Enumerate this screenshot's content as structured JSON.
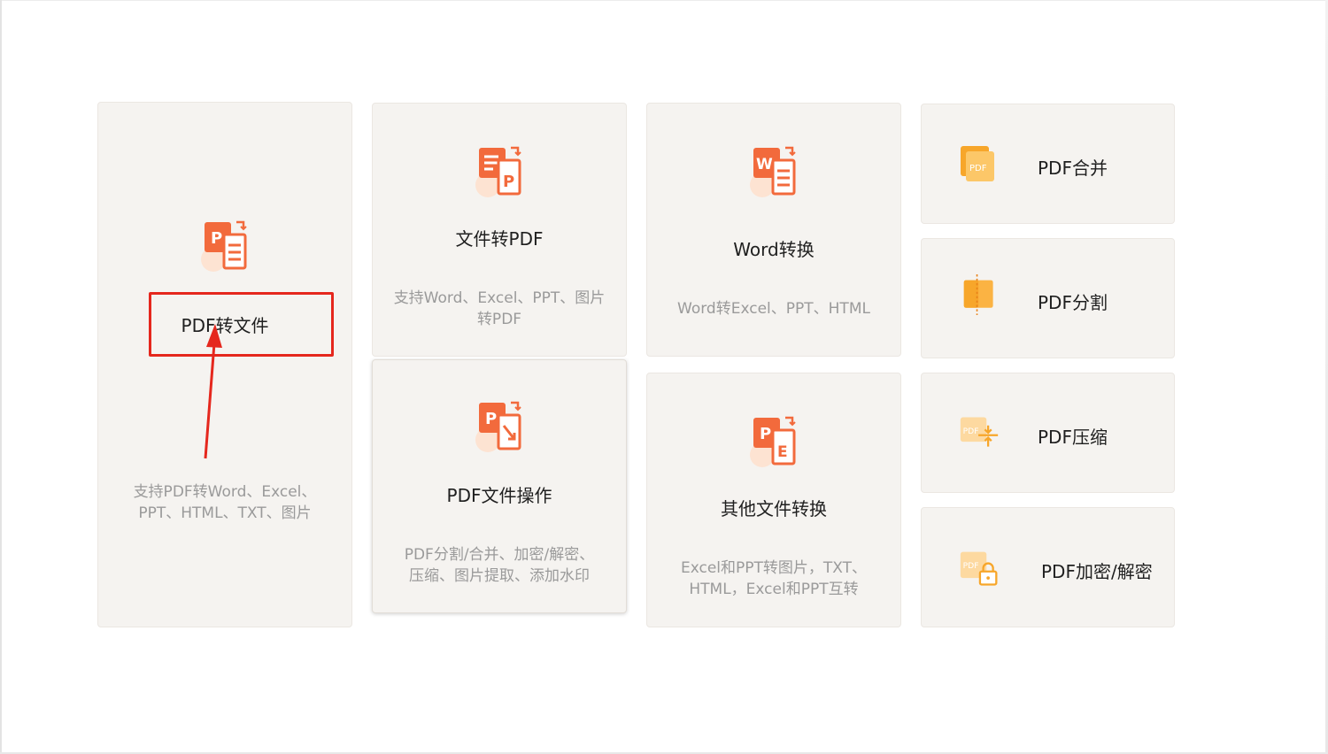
{
  "cards": {
    "pdf_to_file": {
      "title": "PDF转文件",
      "desc_lines": [
        "支持PDF转Word、Excel、",
        "PPT、HTML、TXT、图片"
      ]
    },
    "file_to_pdf": {
      "title": "文件转PDF",
      "desc_lines": [
        "支持Word、Excel、PPT、图片",
        "转PDF"
      ]
    },
    "word_convert": {
      "title": "Word转换",
      "desc_lines": [
        "Word转Excel、PPT、HTML"
      ]
    },
    "pdf_file_ops": {
      "title": "PDF文件操作",
      "desc_lines": [
        "PDF分割/合并、加密/解密、",
        "压缩、图片提取、添加水印"
      ]
    },
    "other_convert": {
      "title": "其他文件转换",
      "desc_lines": [
        "Excel和PPT转图片，TXT、",
        "HTML，Excel和PPT互转"
      ]
    }
  },
  "tools": {
    "merge": {
      "label": "PDF合并"
    },
    "split": {
      "label": "PDF分割"
    },
    "compress": {
      "label": "PDF压缩"
    },
    "encrypt": {
      "label": "PDF加密/解密"
    }
  },
  "icons": {
    "pdf_to_file": "pdf-to-file-icon",
    "file_to_pdf": "file-to-pdf-icon",
    "word_convert": "word-convert-icon",
    "pdf_file_ops": "pdf-ops-icon",
    "other_convert": "other-convert-icon",
    "merge": "pdf-merge-icon",
    "split": "pdf-split-icon",
    "compress": "pdf-compress-icon",
    "encrypt": "pdf-lock-icon"
  },
  "colors": {
    "card_bg": "#f5f3f0",
    "accent_orange": "#f26a3c",
    "accent_yellow": "#fbb343",
    "highlight_red": "#e5271d",
    "title_text": "#1f1f1f",
    "desc_text": "#9a9a9a"
  }
}
